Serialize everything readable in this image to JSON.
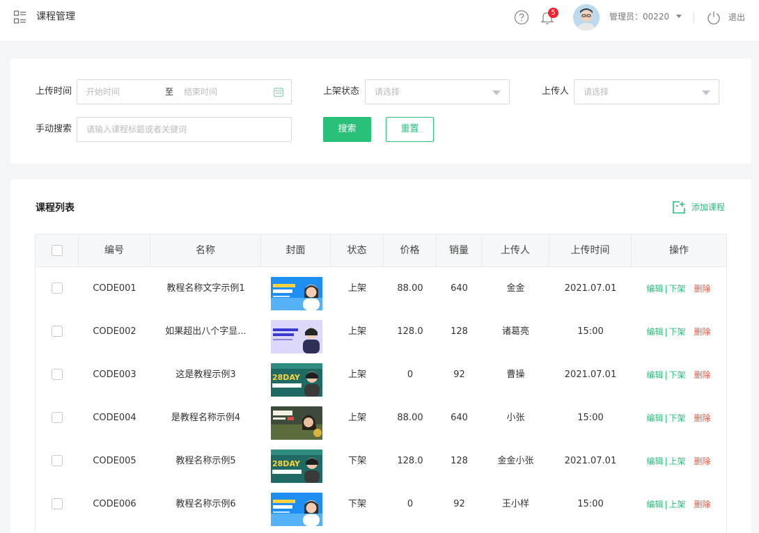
{
  "header": {
    "title": "课程管理",
    "notification_count": "5",
    "admin_label": "管理员：00220",
    "logout_label": "退出"
  },
  "filter": {
    "upload_time_label": "上传时间",
    "start_placeholder": "开始时间",
    "range_sep": "至",
    "end_placeholder": "结束时间",
    "status_label": "上架状态",
    "status_placeholder": "请选择",
    "uploader_label": "上传人",
    "uploader_placeholder": "请选择",
    "keyword_label": "手动搜索",
    "keyword_placeholder": "请输入课程标题或者关键词",
    "search_label": "搜索",
    "reset_label": "重置"
  },
  "list": {
    "title": "课程列表",
    "add_label": "添加课程",
    "columns": [
      "编号",
      "名称",
      "封面",
      "状态",
      "价格",
      "销量",
      "上传人",
      "上传时间",
      "操作"
    ],
    "ops": {
      "edit": "编辑",
      "sep": "|",
      "delete": "删除"
    },
    "rows": [
      {
        "code": "CODE001",
        "name": "教程名称文字示例1",
        "status": "上架",
        "price": "88.00",
        "sales": "640",
        "uploader": "金金",
        "time": "2021.07.01",
        "toggle": "下架",
        "cover": "blue"
      },
      {
        "code": "CODE002",
        "name": "如果超出八个字显...",
        "status": "上架",
        "price": "128.0",
        "sales": "128",
        "uploader": "诸葛亮",
        "time": "15:00",
        "toggle": "下架",
        "cover": "lavender"
      },
      {
        "code": "CODE003",
        "name": "这是教程示例3",
        "status": "上架",
        "price": "0",
        "sales": "92",
        "uploader": "曹操",
        "time": "2021.07.01",
        "toggle": "下架",
        "cover": "teal"
      },
      {
        "code": "CODE004",
        "name": "是教程名称示例4",
        "status": "上架",
        "price": "88.00",
        "sales": "640",
        "uploader": "小张",
        "time": "15:00",
        "toggle": "下架",
        "cover": "dark"
      },
      {
        "code": "CODE005",
        "name": "教程名称示例5",
        "status": "下架",
        "price": "128.0",
        "sales": "128",
        "uploader": "金金小张",
        "time": "2021.07.01",
        "toggle": "上架",
        "cover": "teal"
      },
      {
        "code": "CODE006",
        "name": "教程名称示例6",
        "status": "下架",
        "price": "0",
        "sales": "92",
        "uploader": "王小样",
        "time": "15:00",
        "toggle": "上架",
        "cover": "blue"
      }
    ]
  },
  "colors": {
    "accent": "#29c07a",
    "danger": "#f5533d",
    "badge": "#f5222d"
  }
}
